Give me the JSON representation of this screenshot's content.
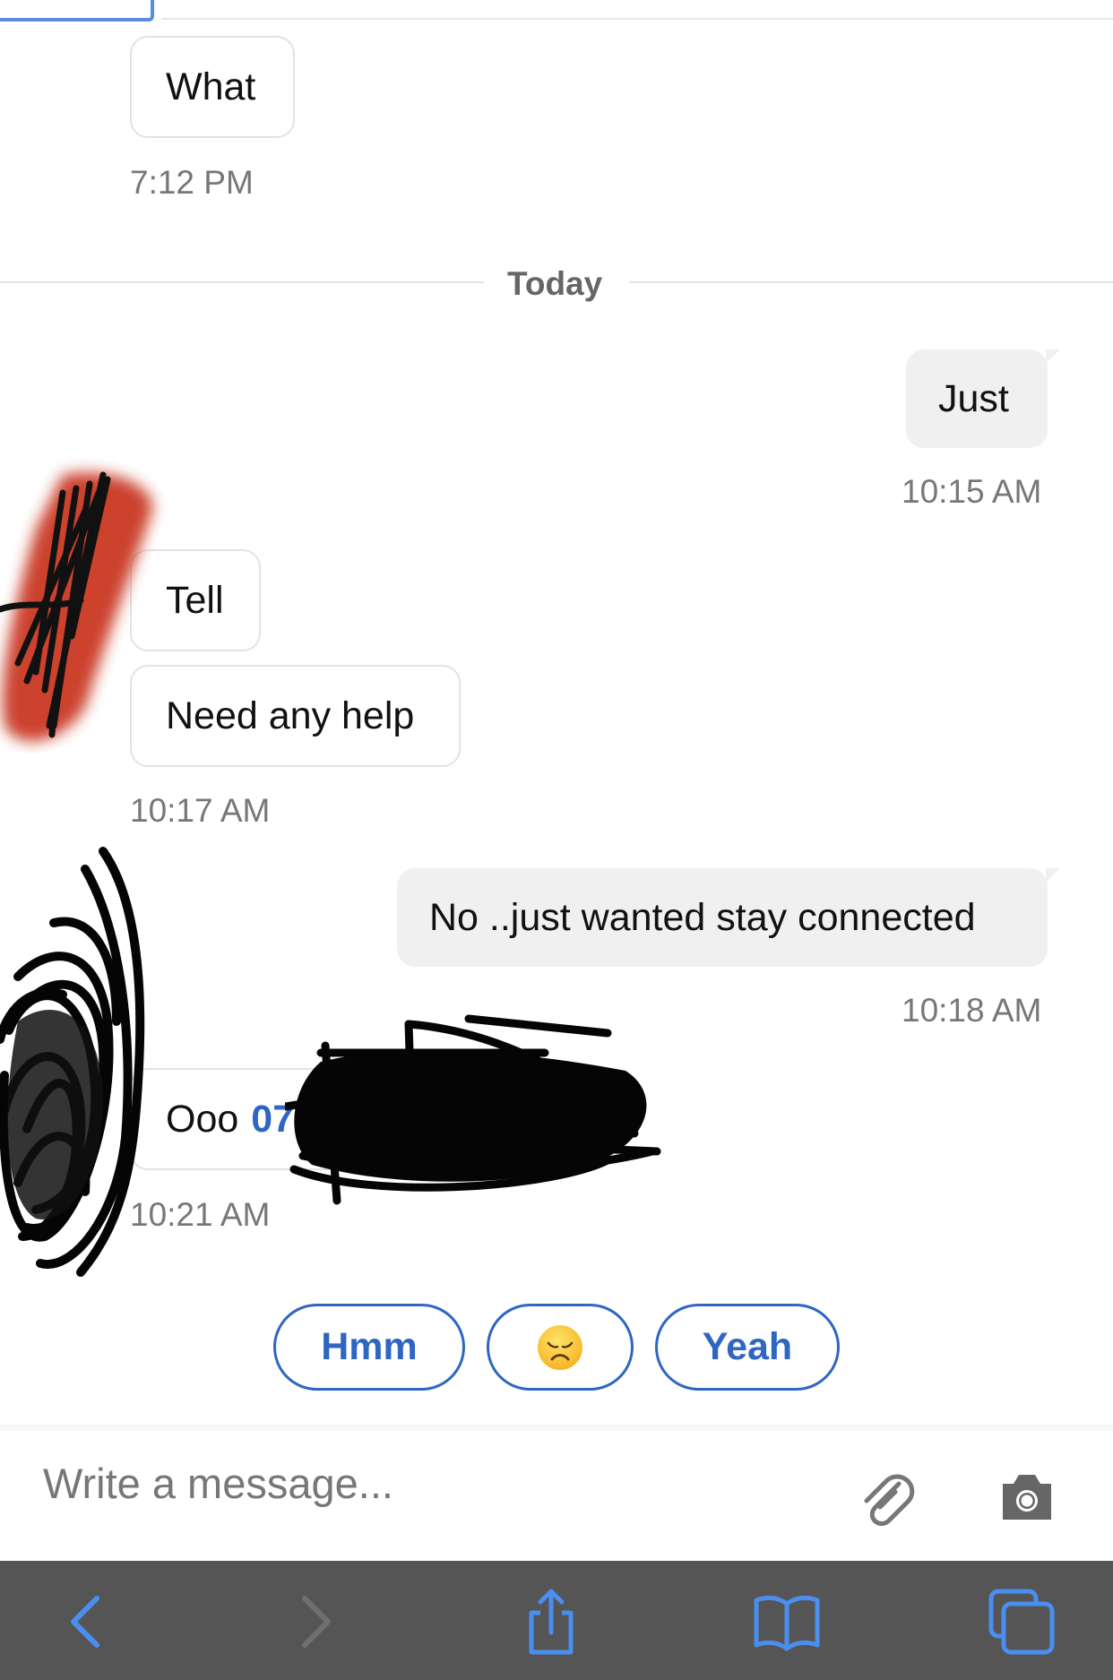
{
  "conversation": {
    "messages": [
      {
        "direction": "incoming",
        "text": "What"
      },
      {
        "direction": "incoming_time",
        "text": "7:12 PM"
      },
      {
        "direction": "outgoing",
        "text": "Just"
      },
      {
        "direction": "outgoing_time",
        "text": "10:15 AM"
      },
      {
        "direction": "incoming",
        "text": "Tell"
      },
      {
        "direction": "incoming",
        "text": "Need any help"
      },
      {
        "direction": "incoming_time",
        "text": "10:17 AM"
      },
      {
        "direction": "outgoing",
        "text": "No ..just wanted stay connected"
      },
      {
        "direction": "outgoing_time",
        "text": "10:18 AM"
      },
      {
        "direction": "incoming",
        "text": "Ooo",
        "link_fragment": "07"
      },
      {
        "direction": "incoming_time",
        "text": "10:21 AM"
      }
    ],
    "day_divider": "Today"
  },
  "quick_replies": [
    {
      "label": "Hmm"
    },
    {
      "label": "😞",
      "icon": "disappointed-face-emoji"
    },
    {
      "label": "Yeah"
    }
  ],
  "composer": {
    "placeholder": "Write a message...",
    "attach_icon": "paperclip-icon",
    "camera_icon": "camera-icon"
  },
  "toolbar": {
    "items": [
      {
        "icon": "back-chevron-icon",
        "enabled": true
      },
      {
        "icon": "forward-chevron-icon",
        "enabled": false
      },
      {
        "icon": "share-icon",
        "enabled": true
      },
      {
        "icon": "bookmarks-book-icon",
        "enabled": true
      },
      {
        "icon": "tabs-icon",
        "enabled": true
      }
    ]
  },
  "colors": {
    "accent": "#2f66c2",
    "toolbar_bg": "#555555",
    "toolbar_icon": "#4a8ef0",
    "outgoing_bubble": "#f0f0f0",
    "timestamp": "#777777"
  }
}
